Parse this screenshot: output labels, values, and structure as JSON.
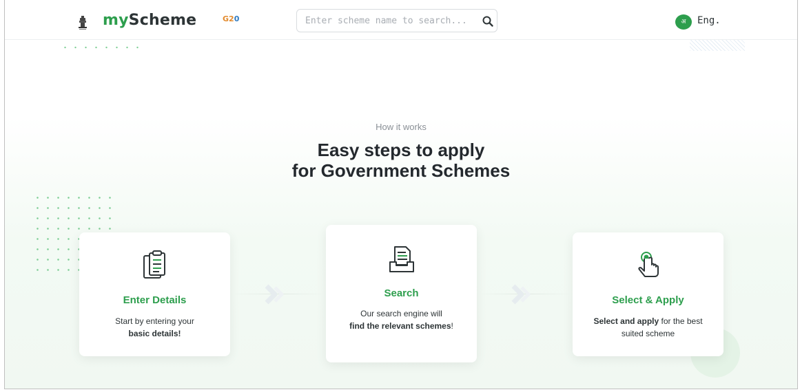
{
  "header": {
    "brand_my": "my",
    "brand_rest": "Scheme",
    "g20_label": "G2",
    "g20_o": "0",
    "search_placeholder": "Enter scheme name to search...",
    "lang_badge": "अ",
    "lang_label": "Eng."
  },
  "hero": {
    "eyebrow": "How it works",
    "headline_line1": "Easy steps to apply",
    "headline_line2": "for Government Schemes"
  },
  "steps": [
    {
      "title": "Enter Details",
      "desc_pre": "Start by entering your",
      "desc_bold": "basic details!",
      "desc_post": "",
      "icon": "clipboard-icon"
    },
    {
      "title": "Search",
      "desc_pre": "Our search engine will",
      "desc_bold": "find the relevant schemes",
      "desc_post": "!",
      "icon": "document-tray-icon"
    },
    {
      "title": "Select & Apply",
      "desc_pre": "",
      "desc_bold": "Select and apply",
      "desc_post": " for the best suited scheme",
      "icon": "tap-hand-icon"
    }
  ],
  "colors": {
    "accent_green": "#2d9e4d",
    "text_dark": "#24292e",
    "muted": "#8a9096"
  }
}
